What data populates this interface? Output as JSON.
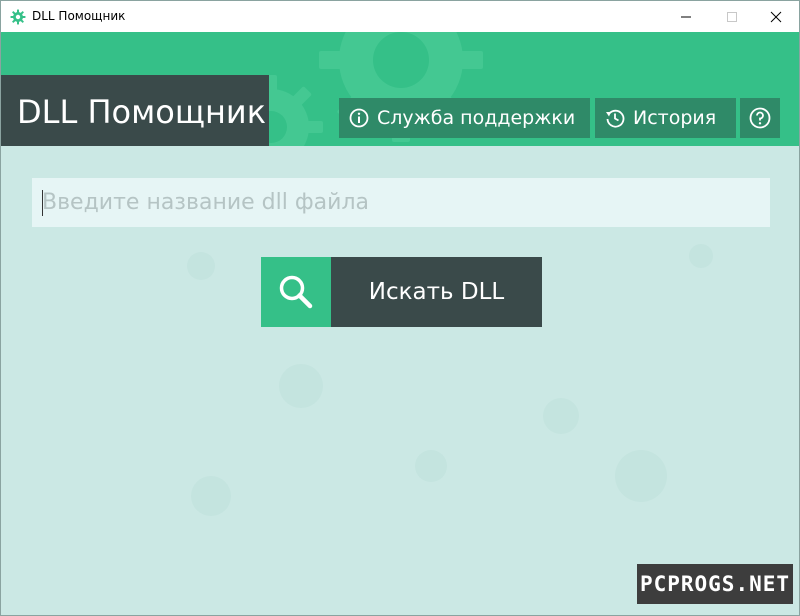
{
  "window": {
    "title": "DLL Помощник"
  },
  "header": {
    "app_title": "DLL Помощник",
    "support_label": "Служба поддержки",
    "history_label": "История",
    "help_icon": "question-circle-icon"
  },
  "search": {
    "placeholder": "Введите название dll файла",
    "value": "",
    "button_label": "Искать DLL"
  },
  "watermark": {
    "text": "PCPROGS.NET"
  },
  "colors": {
    "accent_green": "#35c088",
    "dark_green_button": "#2f8a68",
    "dark_slate": "#3a4a4a",
    "background": "#cbe8e4",
    "input_bg": "#e6f5f5"
  }
}
